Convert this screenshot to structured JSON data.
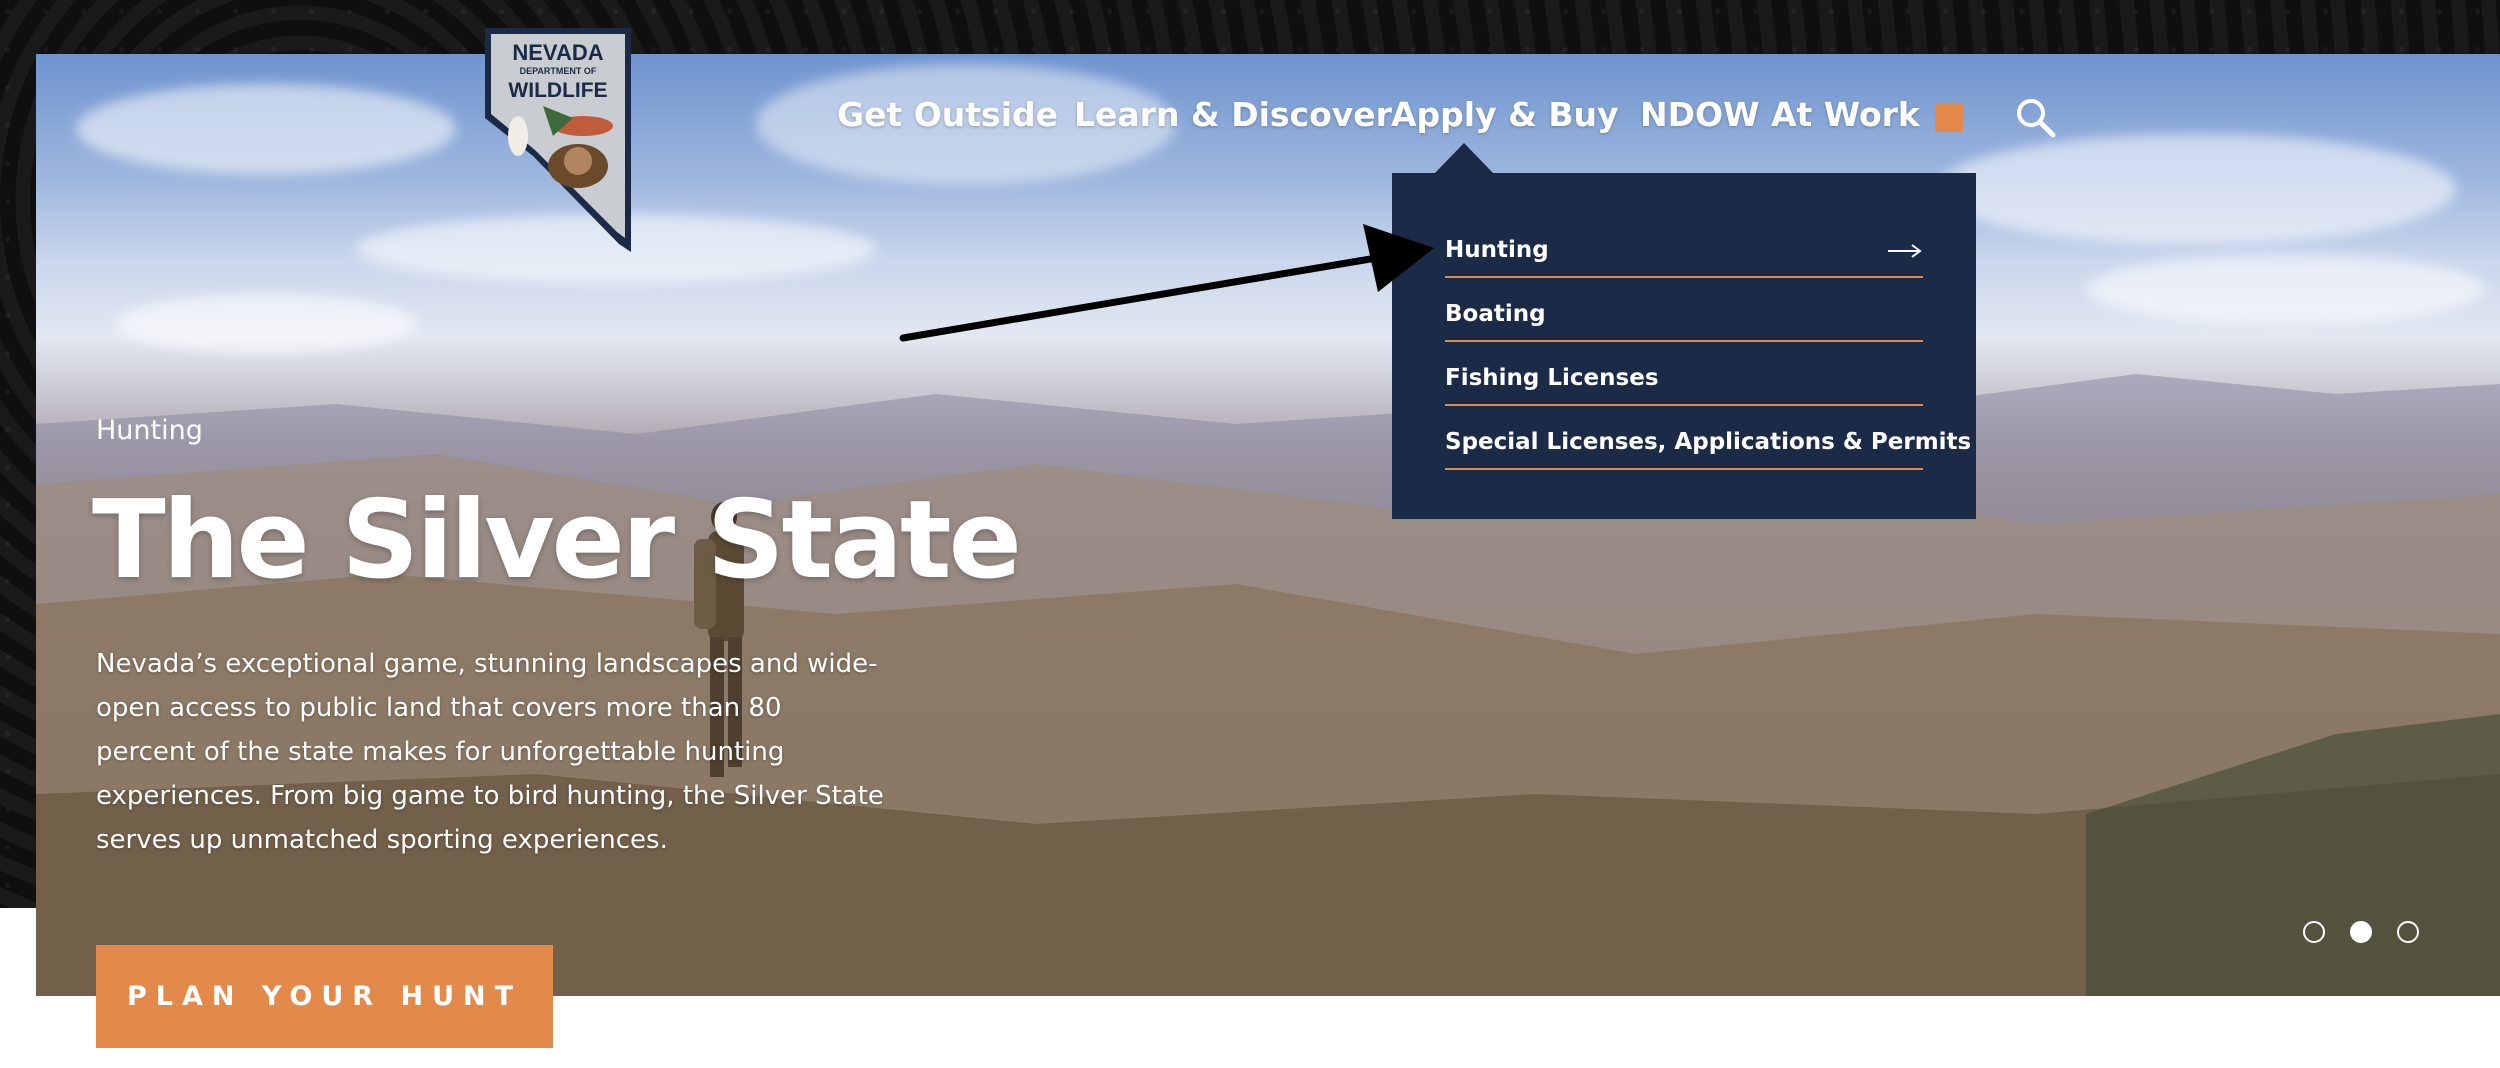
{
  "logo": {
    "line1": "NEVADA",
    "line2": "DEPARTMENT OF",
    "line3": "WILDLIFE"
  },
  "nav": {
    "items": [
      {
        "label": "Get Outside"
      },
      {
        "label": "Learn & Discover"
      },
      {
        "label": "Apply & Buy"
      },
      {
        "label": "NDOW At Work"
      }
    ],
    "search_icon": "search-icon",
    "accent_square_color": "#e38a4a"
  },
  "dropdown": {
    "items": [
      {
        "label": "Hunting",
        "icon": "arrow-right-icon"
      },
      {
        "label": "Boating"
      },
      {
        "label": "Fishing Licenses"
      },
      {
        "label": "Special Licenses, Applications & Permits"
      }
    ],
    "background_color": "#1b2b47",
    "divider_color": "#d98a52"
  },
  "hero": {
    "eyebrow": "Hunting",
    "title": "The Silver State",
    "body": "Nevada’s exceptional game, stunning landscapes and wide-open access to public land that covers more than 80 percent of the state makes for unforgettable hunting experiences. From big game to bird hunting, the Silver State serves up unmatched sporting experiences.",
    "cta_label": "PLAN YOUR HUNT",
    "cta_color": "#e38a4a"
  },
  "carousel": {
    "slide_count": 3,
    "active_index": 1
  }
}
